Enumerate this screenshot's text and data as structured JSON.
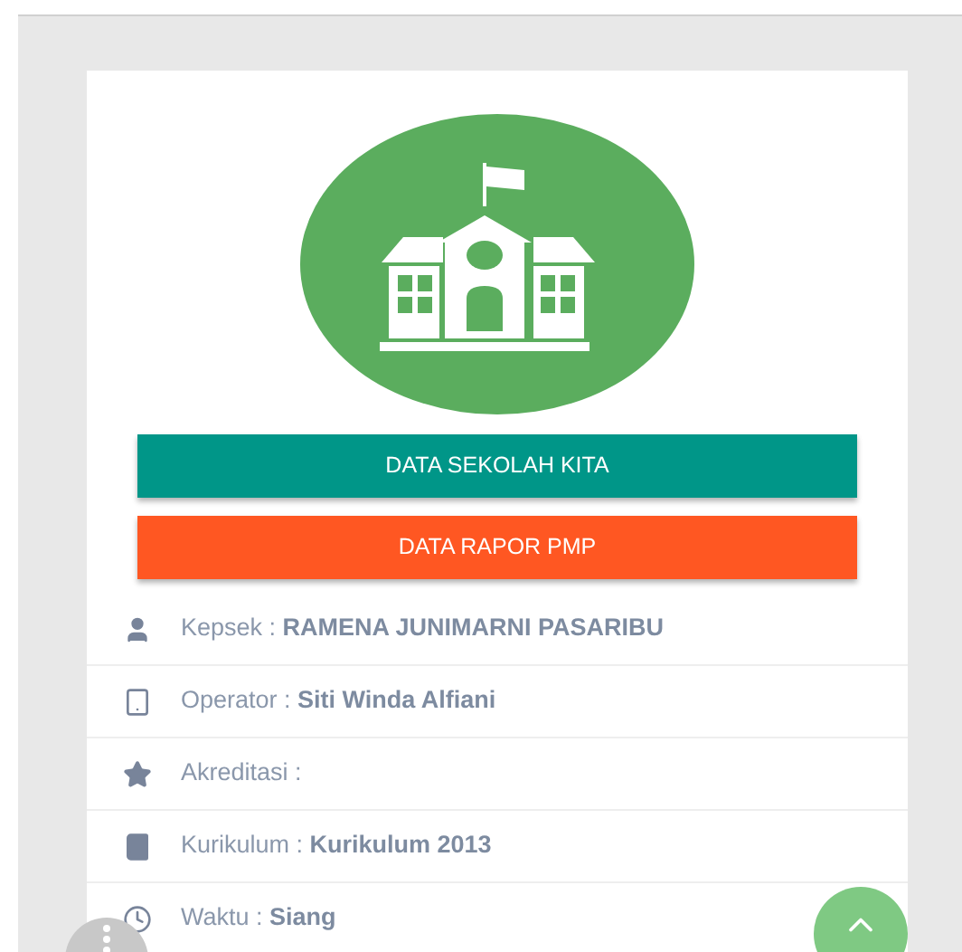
{
  "buttons": [
    {
      "label": "DATA SEKOLAH KITA",
      "kind": "teal"
    },
    {
      "label": "DATA RAPOR PMP",
      "kind": "orange"
    }
  ],
  "info_rows": [
    {
      "kind": "person",
      "label": "Kepsek :",
      "value": "RAMENA JUNIMARNI PASARIBU"
    },
    {
      "kind": "tablet",
      "label": "Operator :",
      "value": "Siti Winda Alfiani"
    },
    {
      "kind": "star",
      "label": "Akreditasi :"
    },
    {
      "kind": "book",
      "label": "Kurikulum :",
      "value": "Kurikulum 2013"
    },
    {
      "kind": "clock",
      "label": "Waktu :",
      "value": "Siang"
    }
  ]
}
